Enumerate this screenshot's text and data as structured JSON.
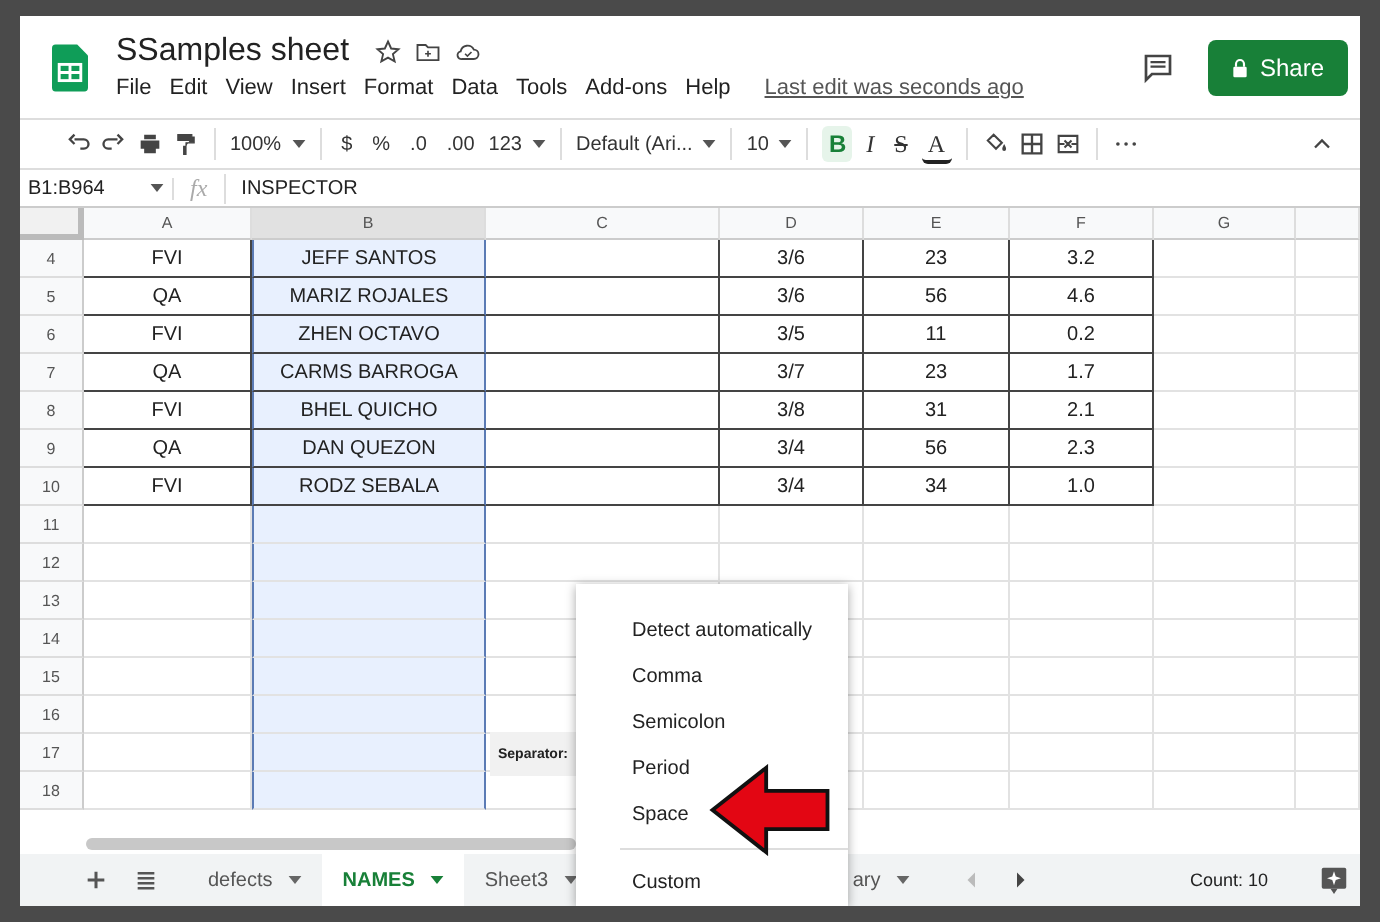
{
  "header": {
    "title": "SSamples sheet",
    "menu": [
      "File",
      "Edit",
      "View",
      "Insert",
      "Format",
      "Data",
      "Tools",
      "Add-ons",
      "Help"
    ],
    "last_edit": "Last edit was seconds ago",
    "share": "Share"
  },
  "toolbar": [
    {
      "kind": "undo"
    },
    {
      "kind": "redo"
    },
    {
      "kind": "print"
    },
    {
      "kind": "paint"
    },
    {
      "kind": "divider"
    },
    {
      "kind": "dropdown",
      "label": "100%"
    },
    {
      "kind": "divider"
    },
    {
      "kind": "text",
      "label": "$"
    },
    {
      "kind": "text",
      "label": "%"
    },
    {
      "kind": "decimal",
      "label": ".0"
    },
    {
      "kind": "decimal",
      "label": ".00"
    },
    {
      "kind": "dropdown",
      "label": "123"
    },
    {
      "kind": "divider"
    },
    {
      "kind": "dropdown",
      "label": "Default (Ari..."
    },
    {
      "kind": "divider"
    },
    {
      "kind": "dropdown",
      "label": "10"
    },
    {
      "kind": "divider"
    },
    {
      "kind": "bold",
      "label": "B",
      "on": true
    },
    {
      "kind": "italic",
      "label": "I",
      "on": false
    },
    {
      "kind": "strike",
      "label": "S",
      "on": false
    },
    {
      "kind": "textcolor",
      "label": "A"
    },
    {
      "kind": "divider"
    },
    {
      "kind": "fill"
    },
    {
      "kind": "borders"
    },
    {
      "kind": "merge"
    },
    {
      "kind": "divider"
    },
    {
      "kind": "more"
    },
    {
      "kind": "collapse"
    }
  ],
  "formula_bar": {
    "name_box": "B1:B964",
    "fx": "fx",
    "value": "INSPECTOR"
  },
  "grid": {
    "columns": [
      {
        "label": "A",
        "selected": false
      },
      {
        "label": "B",
        "selected": true
      },
      {
        "label": "C",
        "selected": false
      },
      {
        "label": "D",
        "selected": false
      },
      {
        "label": "E",
        "selected": false
      },
      {
        "label": "F",
        "selected": false
      },
      {
        "label": "G",
        "selected": false
      }
    ],
    "rows": [
      {
        "number": "4",
        "cells": [
          "FVI",
          "JEFF SANTOS",
          "",
          "3/6",
          "23",
          "3.2"
        ]
      },
      {
        "number": "5",
        "cells": [
          "QA",
          "MARIZ ROJALES",
          "",
          "3/6",
          "56",
          "4.6"
        ]
      },
      {
        "number": "6",
        "cells": [
          "FVI",
          "ZHEN OCTAVO",
          "",
          "3/5",
          "11",
          "0.2"
        ]
      },
      {
        "number": "7",
        "cells": [
          "QA",
          "CARMS BARROGA",
          "",
          "3/7",
          "23",
          "1.7"
        ]
      },
      {
        "number": "8",
        "cells": [
          "FVI",
          "BHEL QUICHO",
          "",
          "3/8",
          "31",
          "2.1"
        ]
      },
      {
        "number": "9",
        "cells": [
          "QA",
          "DAN QUEZON",
          "",
          "3/4",
          "56",
          "2.3"
        ]
      },
      {
        "number": "10",
        "cells": [
          "FVI",
          "RODZ SEBALA",
          "",
          "3/4",
          "34",
          "1.0"
        ]
      },
      {
        "number": "11"
      },
      {
        "number": "12"
      },
      {
        "number": "13"
      },
      {
        "number": "14"
      },
      {
        "number": "15"
      },
      {
        "number": "16"
      },
      {
        "number": "17"
      },
      {
        "number": "18"
      }
    ]
  },
  "separator_popup": {
    "label": "Separator:",
    "options": [
      "Detect automatically",
      "Comma",
      "Semicolon",
      "Period",
      "Space"
    ],
    "custom": "Custom"
  },
  "sheet_tabs": [
    {
      "label": "defects",
      "selected": false
    },
    {
      "label": "NAMES",
      "selected": true
    },
    {
      "label": "Sheet3",
      "selected": false
    },
    {
      "label": "ary",
      "selected": false
    }
  ],
  "status": "Count: 10"
}
